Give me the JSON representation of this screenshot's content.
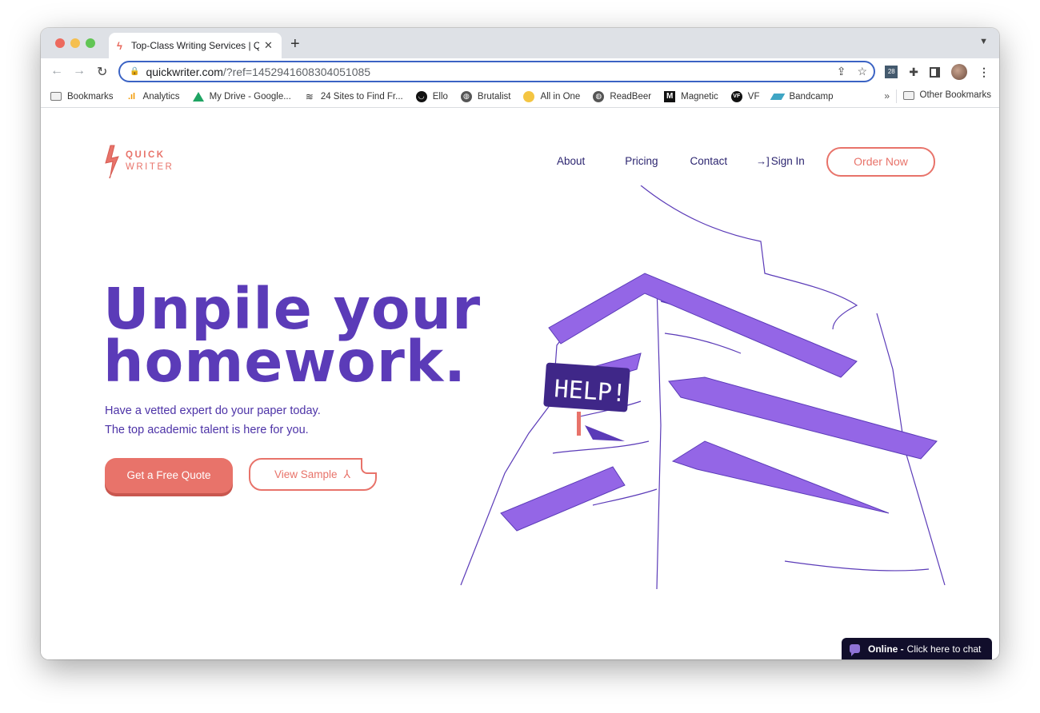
{
  "browser": {
    "tab": {
      "title": "Top-Class Writing Services | Q",
      "favicon": "bolt-icon"
    },
    "url": {
      "domain": "quickwriter.com",
      "path": "/?ref=1452941608304051085"
    },
    "bookmarks": [
      {
        "label": "Bookmarks",
        "icon": "folder-icon"
      },
      {
        "label": "Analytics",
        "icon": "analytics-icon"
      },
      {
        "label": "My Drive - Google...",
        "icon": "drive-icon"
      },
      {
        "label": "24 Sites to Find Fr...",
        "icon": "stack-icon"
      },
      {
        "label": "Ello",
        "icon": "ello-icon"
      },
      {
        "label": "Brutalist",
        "icon": "globe-icon"
      },
      {
        "label": "All in One",
        "icon": "allinone-icon"
      },
      {
        "label": "ReadBeer",
        "icon": "globe-icon"
      },
      {
        "label": "Magnetic",
        "icon": "magnetic-icon"
      },
      {
        "label": "VF",
        "icon": "vf-icon"
      },
      {
        "label": "Bandcamp",
        "icon": "bandcamp-icon"
      }
    ],
    "more_bookmarks": "»",
    "other_bookmarks": "Other Bookmarks",
    "calendar_ext_day": "28"
  },
  "site": {
    "logo": {
      "line1": "QUICK",
      "line2": "WRITER"
    },
    "nav": {
      "about": "About",
      "pricing": "Pricing",
      "contact": "Contact",
      "signin": "Sign In",
      "order": "Order Now"
    },
    "hero": {
      "title_line1": "Unpile your",
      "title_line2": "homework.",
      "sub_line1": "Have a vetted expert do your paper today.",
      "sub_line2": "The top academic talent is here for you.",
      "quote_button": "Get a Free Quote",
      "sample_button": "View Sample"
    },
    "illustration": {
      "sign_text": "HELP!"
    },
    "chat": {
      "status": "Online -",
      "cta": "Click here to chat"
    },
    "colors": {
      "brand_coral": "#e8736a",
      "brand_purple": "#5b3bb8",
      "nav_text": "#2c2570",
      "folder_purple": "#9466e6"
    }
  }
}
